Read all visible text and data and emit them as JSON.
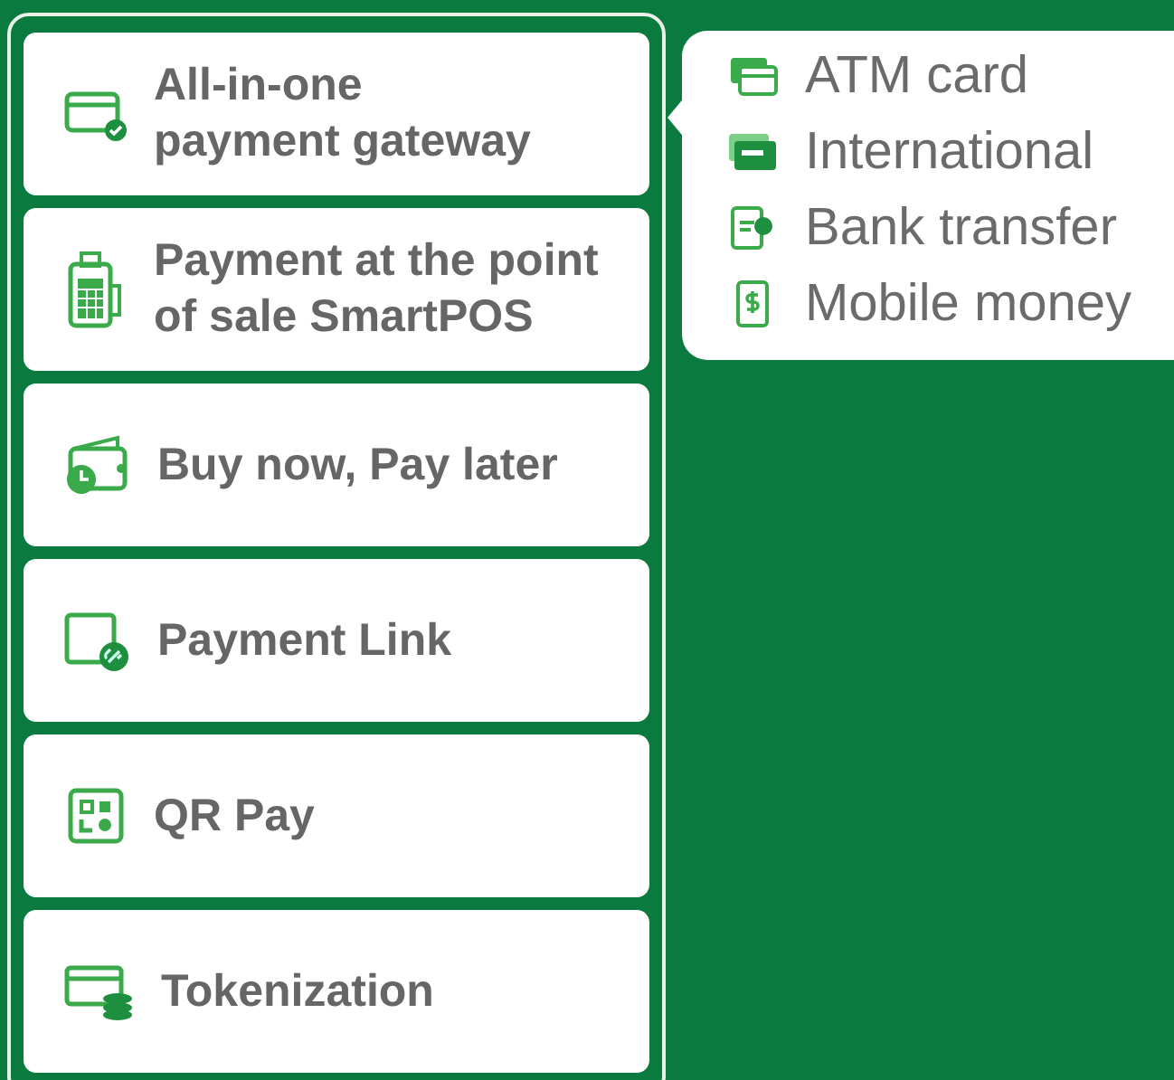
{
  "menu": [
    {
      "lines": [
        "All-in-one",
        "payment gateway"
      ],
      "submenu": [
        {
          "label": "ATM card"
        },
        {
          "label": "International"
        },
        {
          "label": "Bank transfer"
        },
        {
          "label": "Mobile money"
        }
      ]
    },
    {
      "lines": [
        "Payment at the point",
        "of sale SmartPOS"
      ]
    },
    {
      "lines": [
        "Buy now, Pay later"
      ]
    },
    {
      "lines": [
        "Payment Link"
      ]
    },
    {
      "lines": [
        "QR Pay"
      ]
    },
    {
      "lines": [
        "Tokenization"
      ]
    }
  ]
}
